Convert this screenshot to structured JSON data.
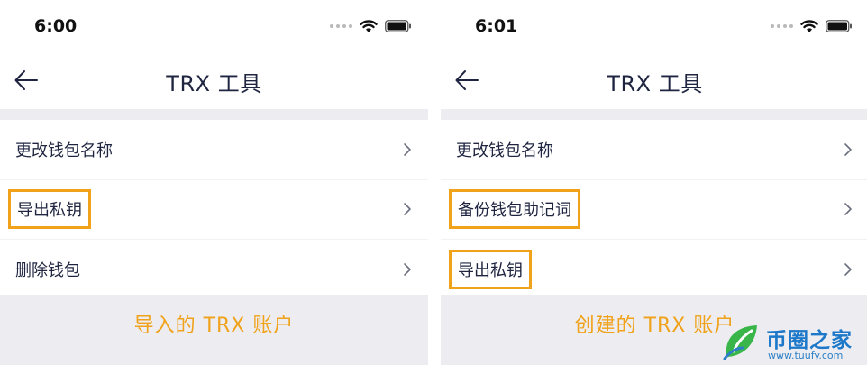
{
  "left_phone": {
    "status_time": "6:00",
    "nav_title": "TRX 工具",
    "rows": [
      {
        "label": "更改钱包名称"
      },
      {
        "label": "导出私钥"
      },
      {
        "label": "删除钱包"
      }
    ],
    "caption": "导入的 TRX 账户"
  },
  "right_phone": {
    "status_time": "6:01",
    "nav_title": "TRX 工具",
    "rows": [
      {
        "label": "更改钱包名称"
      },
      {
        "label": "备份钱包助记词"
      },
      {
        "label": "导出私钥"
      }
    ],
    "caption": "创建的 TRX 账户"
  },
  "watermark": {
    "title": "币圈之家",
    "url": "www.tuufy.com"
  },
  "colors": {
    "highlight": "#f0a21a",
    "caption_background": "#ececf1",
    "text_primary": "#1f2540",
    "watermark_blue": "#1d78c9",
    "watermark_green": "#39b54a"
  },
  "icons": [
    "back-arrow-icon",
    "chevron-right-icon",
    "wifi-icon",
    "battery-icon",
    "signal-dots-icon"
  ]
}
